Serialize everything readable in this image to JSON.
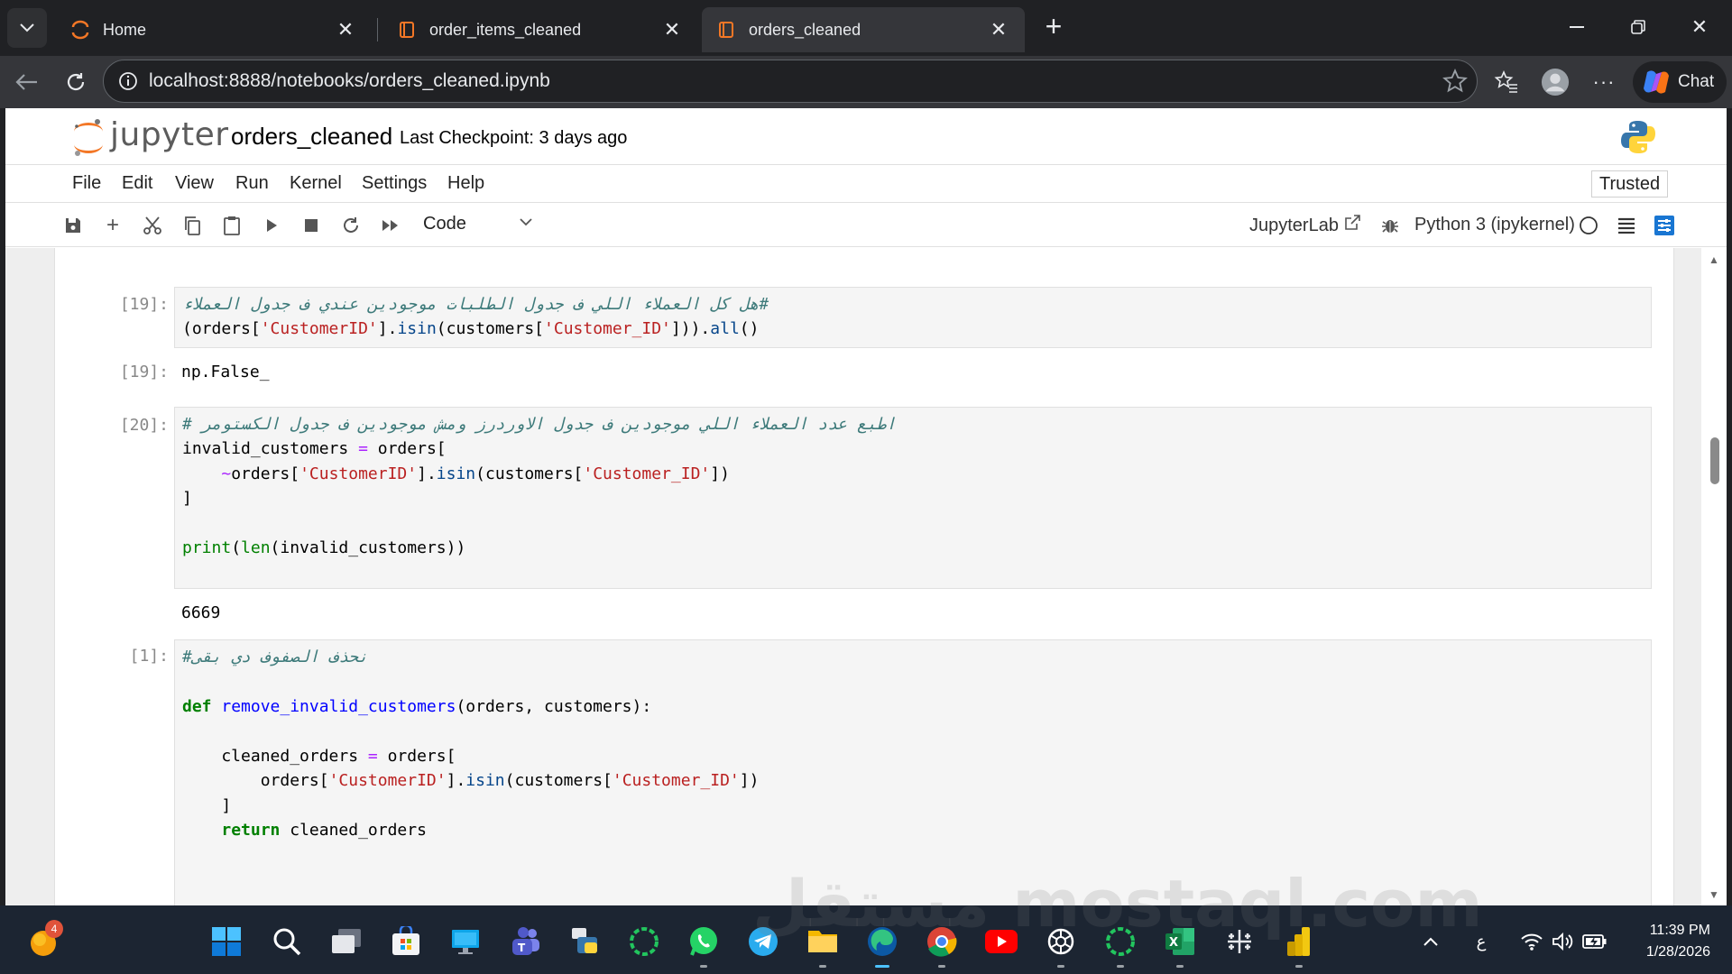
{
  "browser": {
    "tabs": [
      {
        "title": "Home",
        "active": false
      },
      {
        "title": "order_items_cleaned",
        "active": false
      },
      {
        "title": "orders_cleaned",
        "active": true
      }
    ],
    "url": "localhost:8888/notebooks/orders_cleaned.ipynb",
    "chat_label": "Chat"
  },
  "jupyter": {
    "logo_text": "jupyter",
    "notebook_name": "orders_cleaned",
    "checkpoint": "Last Checkpoint: 3 days ago",
    "menu": [
      "File",
      "Edit",
      "View",
      "Run",
      "Kernel",
      "Settings",
      "Help"
    ],
    "trusted": "Trusted",
    "cell_type": "Code",
    "jupyterlab_label": "JupyterLab",
    "kernel": "Python 3 (ipykernel)"
  },
  "cells": [
    {
      "prompt": "[19]:",
      "lines": [
        "#هل كل العملاء اللي ف جدول الطلبات موجودين عندي ف جدول العملاء",
        "(orders['CustomerID'].isin(customers['Customer_ID'])).all()"
      ],
      "output_prompt": "[19]:",
      "output": "np.False_"
    },
    {
      "prompt": "[20]:",
      "lines": [
        "# اطبع عدد العملاء اللي موجودين ف جدول الاوردرز ومش موجودين ف جدول الكستومر",
        "invalid_customers = orders[",
        "    ~orders['CustomerID'].isin(customers['Customer_ID'])",
        "]",
        "",
        "print(len(invalid_customers))"
      ],
      "output": "6669"
    },
    {
      "prompt": "[1]:",
      "lines": [
        "#نحذف الصفوف دي بقى",
        "",
        "def remove_invalid_customers(orders, customers):",
        "",
        "    cleaned_orders = orders[",
        "        orders['CustomerID'].isin(customers['Customer_ID'])",
        "    ]",
        "    return cleaned_orders"
      ]
    }
  ],
  "taskbar": {
    "notification_count": "4",
    "time": "11:39 PM",
    "date": "1/28/2026",
    "language": "ع"
  },
  "watermark": "مستقل mostaql.com"
}
